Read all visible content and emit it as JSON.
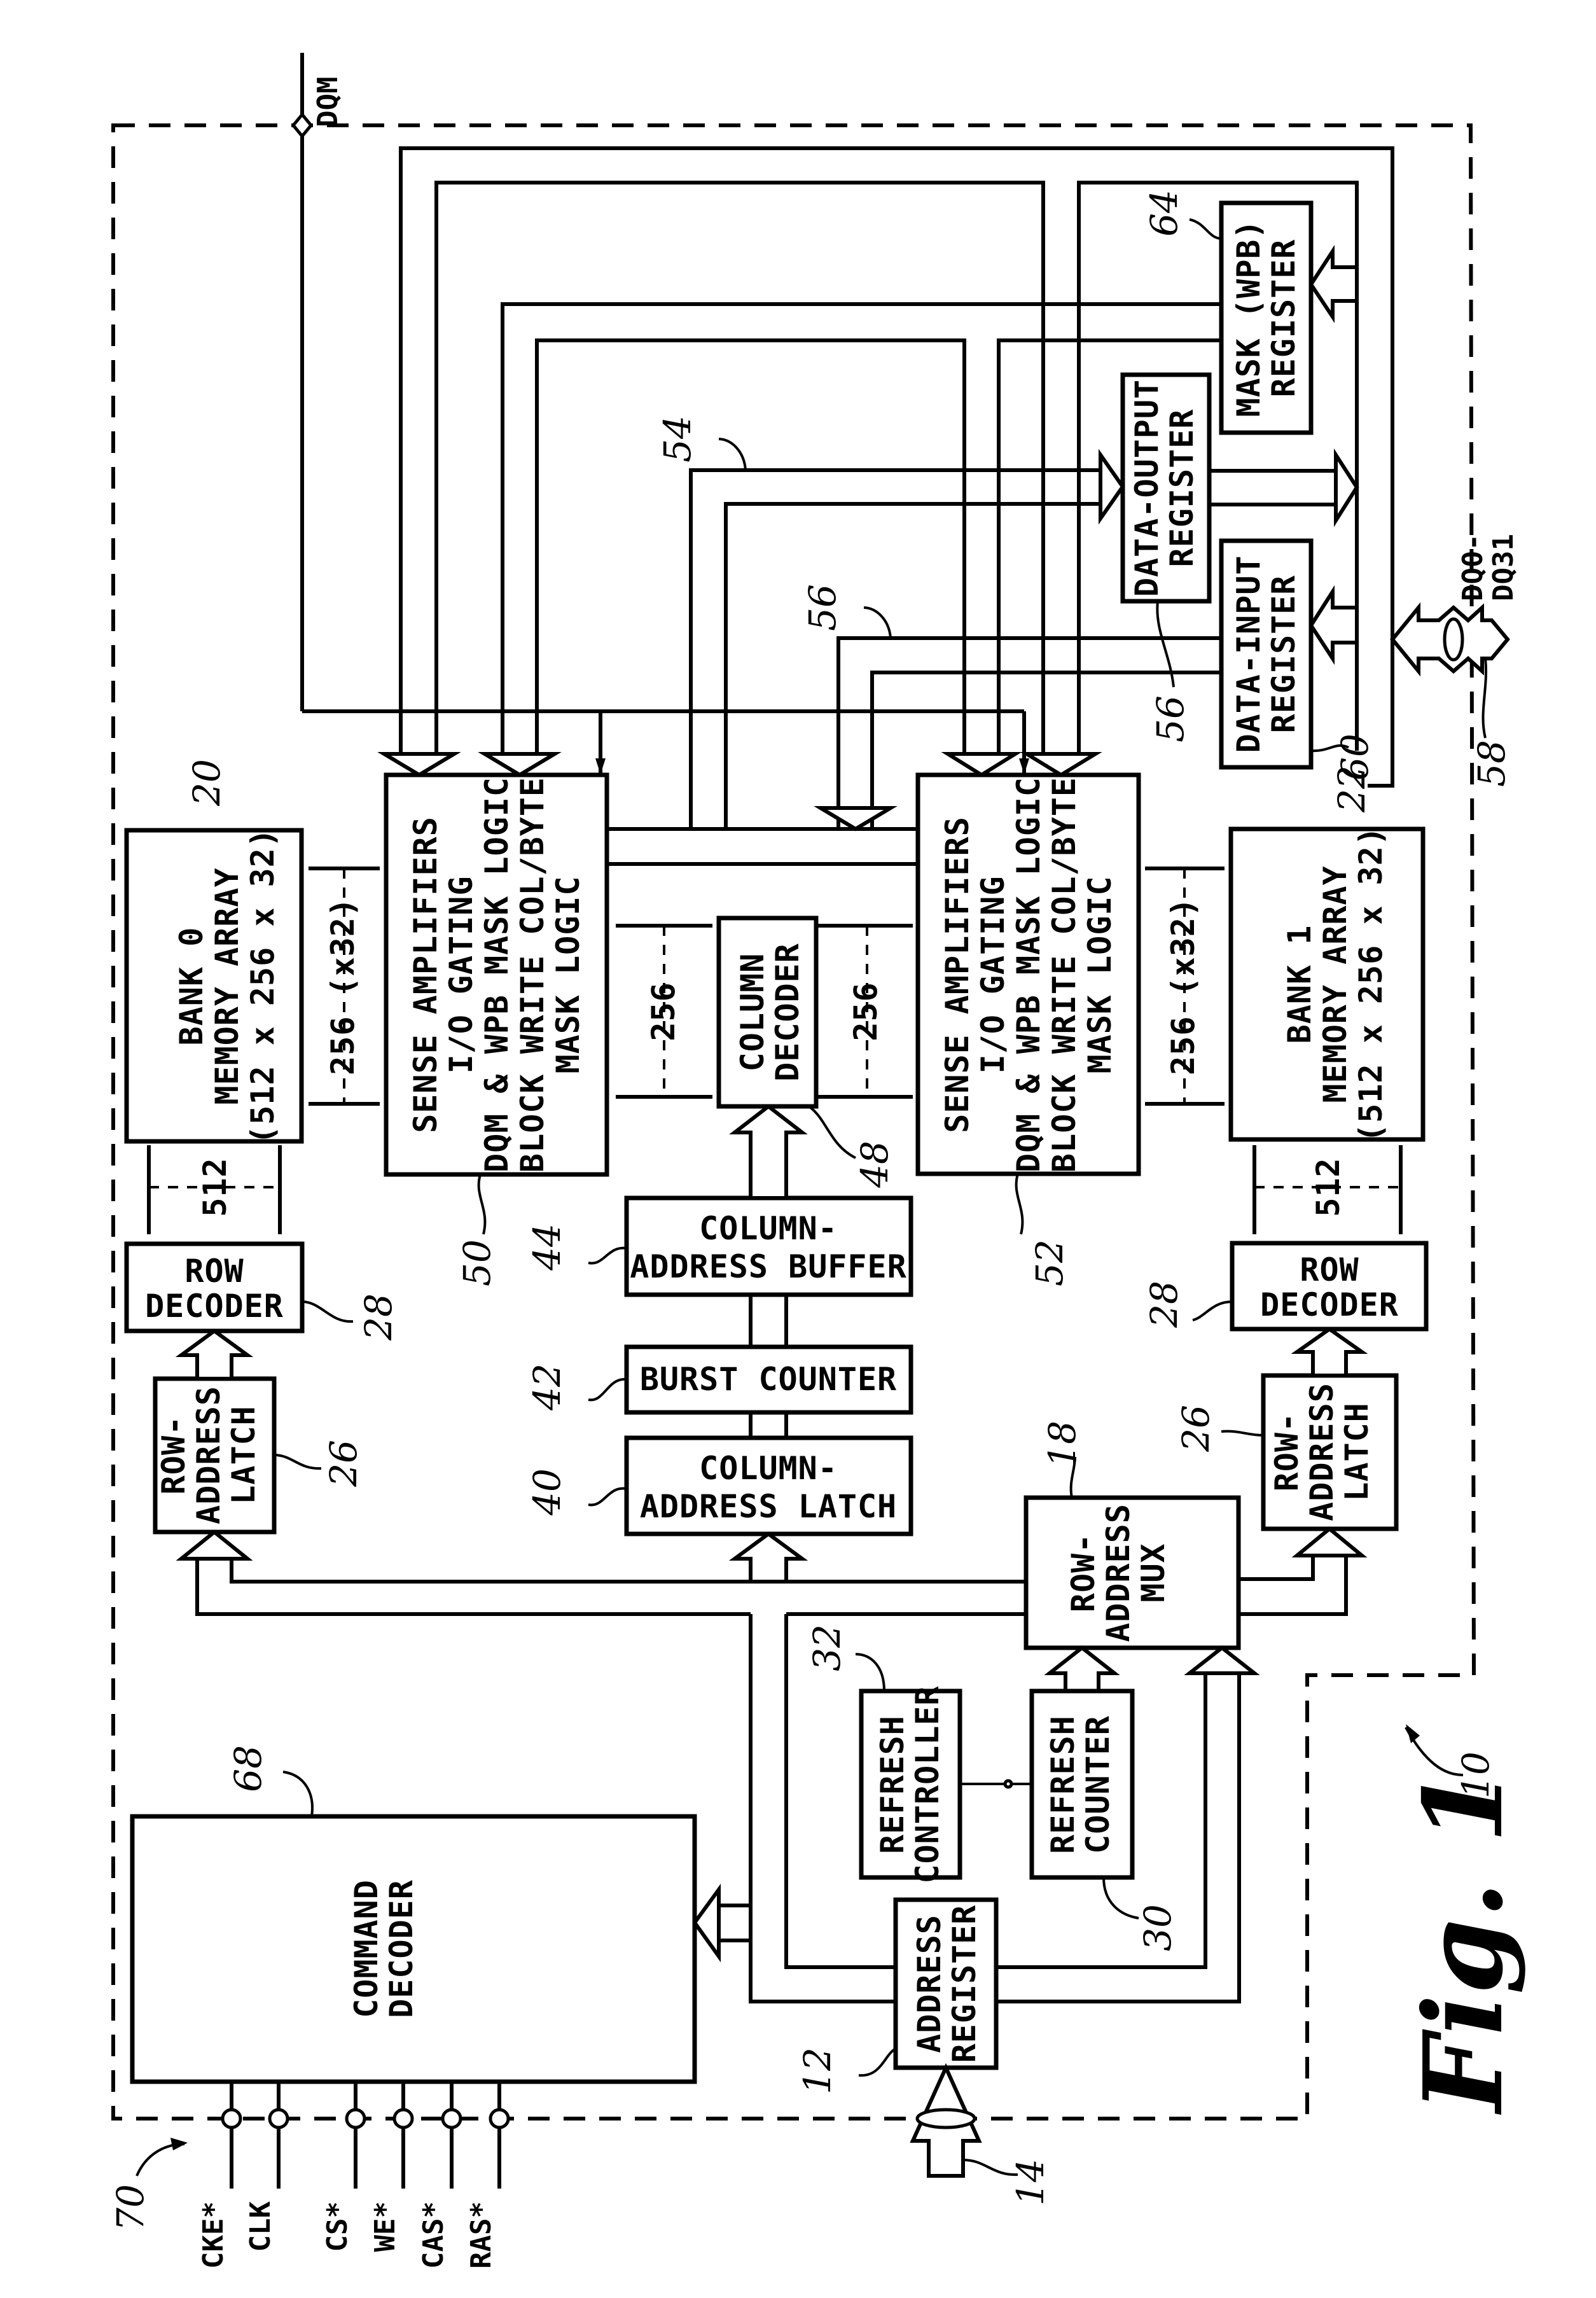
{
  "figure": {
    "title": "Fig. 1",
    "device_ref": "10"
  },
  "signals": {
    "dqm": "DQM",
    "dq_bus": [
      "DQ0-",
      "DQ31"
    ],
    "control_pins": [
      "CKE*",
      "CLK",
      "CS*",
      "WE*",
      "CAS*",
      "RAS*"
    ],
    "control_ref": "70",
    "address_input_ref": "14",
    "dq_ref": "58"
  },
  "blocks": {
    "bank0": {
      "lines": [
        "BANK 0",
        "MEMORY ARRAY",
        "(512 x 256 x 32)"
      ],
      "ref": "20"
    },
    "bank1": {
      "lines": [
        "BANK 1",
        "MEMORY ARRAY",
        "(512 x 256 x 32)"
      ],
      "ref": "22"
    },
    "sense_amp_0": {
      "lines": [
        "SENSE AMPLIFIERS",
        "I/O GATING",
        "DQM & WPB MASK LOGIC",
        "BLOCK WRITE COL/BYTE",
        "MASK LOGIC"
      ],
      "ref": "50"
    },
    "sense_amp_1": {
      "lines": [
        "SENSE AMPLIFIERS",
        "I/O GATING",
        "DQM & WPB MASK LOGIC",
        "BLOCK WRITE COL/BYTE",
        "MASK LOGIC"
      ],
      "ref": "52"
    },
    "column_decoder": {
      "lines": [
        "COLUMN",
        "DECODER"
      ],
      "ref": "48"
    },
    "column_address_buffer": {
      "lines": [
        "COLUMN-",
        "ADDRESS BUFFER"
      ],
      "ref": "44"
    },
    "burst_counter": {
      "lines": [
        "BURST COUNTER"
      ],
      "ref": "42"
    },
    "column_address_latch": {
      "lines": [
        "COLUMN-",
        "ADDRESS LATCH"
      ],
      "ref": "40"
    },
    "row_decoder_0": {
      "lines": [
        "ROW",
        "DECODER"
      ],
      "ref": "28"
    },
    "row_decoder_1": {
      "lines": [
        "ROW",
        "DECODER"
      ],
      "ref": "28"
    },
    "row_address_latch_0": {
      "lines": [
        "ROW-",
        "ADDRESS",
        "LATCH"
      ],
      "ref": "26"
    },
    "row_address_latch_1": {
      "lines": [
        "ROW-",
        "ADDRESS",
        "LATCH"
      ],
      "ref": "26"
    },
    "row_address_mux": {
      "lines": [
        "ROW-",
        "ADDRESS",
        "MUX"
      ],
      "ref": "18"
    },
    "refresh_controller": {
      "lines": [
        "REFRESH",
        "CONTROLLER"
      ],
      "ref": "32"
    },
    "refresh_counter": {
      "lines": [
        "REFRESH",
        "COUNTER"
      ],
      "ref": "30"
    },
    "address_register": {
      "lines": [
        "ADDRESS",
        "REGISTER"
      ],
      "ref": "12"
    },
    "command_decoder": {
      "lines": [
        "COMMAND",
        "DECODER"
      ],
      "ref": "68"
    },
    "mask_register": {
      "lines": [
        "MASK (WPB)",
        "REGISTER"
      ],
      "ref": "64"
    },
    "data_output_register": {
      "lines": [
        "DATA-OUTPUT",
        "REGISTER"
      ],
      "ref": "56"
    },
    "data_input_register": {
      "lines": [
        "DATA-INPUT",
        "REGISTER"
      ],
      "ref": "60"
    }
  },
  "bus_labels": {
    "bank_to_sa_0": "256 (x32)",
    "bank_to_sa_1": "256 (x32)",
    "sa0_to_coldec": "256",
    "coldec_to_sa1": "256",
    "bank0_to_rowdec": "512",
    "bank1_to_rowdec": "512",
    "bus_54_ref": "54",
    "bus_56_ref": "56"
  }
}
